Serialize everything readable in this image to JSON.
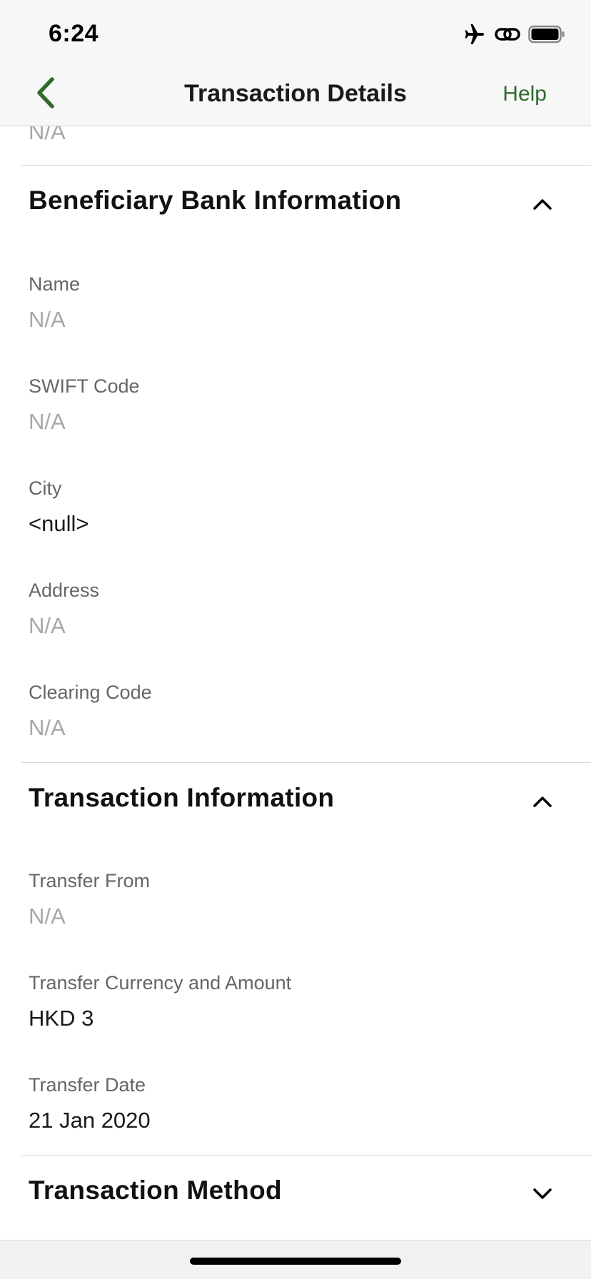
{
  "status_bar": {
    "time": "6:24"
  },
  "nav": {
    "title": "Transaction Details",
    "help_label": "Help",
    "back_icon": "chevron-left-icon"
  },
  "colors": {
    "accent": "#2f6b2c",
    "muted_value": "#a7a7a7",
    "label": "#666666"
  },
  "top_partial": {
    "value": "N/A"
  },
  "beneficiary_bank": {
    "title": "Beneficiary Bank Information",
    "expanded": true,
    "fields": [
      {
        "label": "Name",
        "value": "N/A"
      },
      {
        "label": "SWIFT Code",
        "value": "N/A"
      },
      {
        "label": "City",
        "value": "<null>"
      },
      {
        "label": "Address",
        "value": "N/A"
      },
      {
        "label": "Clearing Code",
        "value": "N/A"
      }
    ]
  },
  "transaction_info": {
    "title": "Transaction Information",
    "expanded": true,
    "fields": [
      {
        "label": "Transfer From",
        "value": "N/A"
      },
      {
        "label": "Transfer Currency and Amount",
        "value": "HKD 3"
      },
      {
        "label": "Transfer Date",
        "value": "21 Jan 2020"
      }
    ]
  },
  "transaction_method": {
    "title": "Transaction Method",
    "expanded": false
  }
}
